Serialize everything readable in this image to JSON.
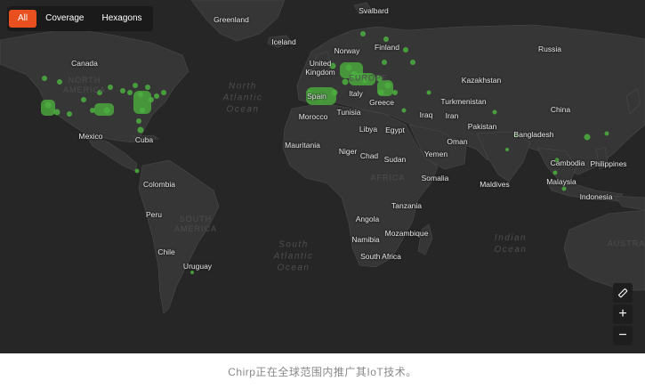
{
  "tabs": [
    {
      "label": "All",
      "active": true
    },
    {
      "label": "Coverage",
      "active": false
    },
    {
      "label": "Hexagons",
      "active": false
    }
  ],
  "map": {
    "coverage_color": "#4caf3f",
    "countries": {
      "svalbard": "Svalbard",
      "greenland": "Greenland",
      "iceland": "Iceland",
      "norway": "Norway",
      "finland": "Finland",
      "russia": "Russia",
      "canada": "Canada",
      "united_kingdom": "United\nKingdom",
      "kazakhstan": "Kazakhstan",
      "spain": "Spain",
      "italy": "Italy",
      "greece": "Greece",
      "turkmenistan": "Turkmenistan",
      "morocco": "Morocco",
      "tunisia": "Tunisia",
      "iraq": "Iraq",
      "iran": "Iran",
      "china": "China",
      "mexico": "Mexico",
      "cuba": "Cuba",
      "libya": "Libya",
      "egypt": "Egypt",
      "pakistan": "Pakistan",
      "bangladesh": "Bangladesh",
      "oman": "Oman",
      "mauritania": "Mauritania",
      "niger": "Niger",
      "chad": "Chad",
      "sudan": "Sudan",
      "yemen": "Yemen",
      "cambodia": "Cambodia",
      "philippines": "Philippines",
      "colombia": "Colombia",
      "somalia": "Somalia",
      "maldives": "Maldives",
      "malaysia": "Malaysia",
      "indonesia": "Indonesia",
      "peru": "Peru",
      "tanzania": "Tanzania",
      "angola": "Angola",
      "namibia": "Namibia",
      "mozambique": "Mozambique",
      "chile": "Chile",
      "south_africa": "South Africa",
      "uruguay": "Uruguay"
    },
    "continents": {
      "north_america": "NORTH\nAMERICA",
      "europe": "EUROPE",
      "south_america": "SOUTH\nAMERICA",
      "africa": "AFRICA",
      "australia": "AUSTRA"
    },
    "oceans": {
      "north_atlantic": "North\nAtlantic\nOcean",
      "south_atlantic": "South\nAtlantic\nOcean",
      "indian": "Indian\nOcean"
    }
  },
  "controls": {
    "ruler_icon": "ruler-icon",
    "zoom_in": "+",
    "zoom_out": "−"
  },
  "caption": "Chirp正在全球范围内推广其IoT技术。"
}
